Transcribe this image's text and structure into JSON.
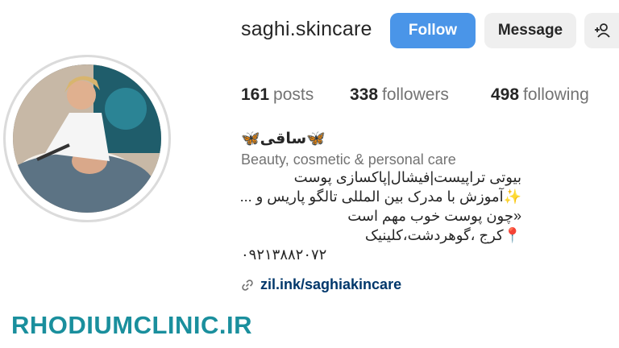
{
  "profile": {
    "username": "saghi.skincare",
    "display_name": "🦋ساقی🦋",
    "category": "Beauty, cosmetic & personal care",
    "bio_lines": [
      "بیوتی تراپیست|فیشال|پاکسازی پوست",
      "✨آموزش با مدرک بین المللی تالگو پاریس و ...",
      "«چون پوست خوب مهم است",
      "📍کرج ،گوهردشت،کلینیک",
      "۰۹۲۱۳۸۸۲۰۷۲"
    ],
    "link": "zil.ink/saghiakincare"
  },
  "buttons": {
    "follow": "Follow",
    "message": "Message",
    "suggest": "+​"
  },
  "stats": {
    "posts_count": "161",
    "posts_label": "posts",
    "followers_count": "338",
    "followers_label": "followers",
    "following_count": "498",
    "following_label": "following"
  },
  "watermark": "RHODIUMCLINIC.IR",
  "colors": {
    "follow_button": "#4a95e8",
    "secondary_button": "#efefef",
    "link": "#00376b",
    "watermark": "#1a8f9d"
  }
}
